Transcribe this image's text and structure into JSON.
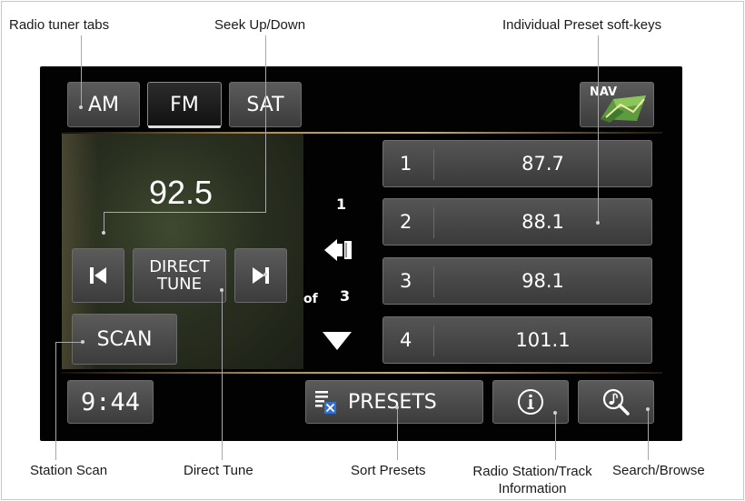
{
  "callouts": {
    "radio_tuner_tabs": "Radio tuner tabs",
    "seek_up_down": "Seek Up/Down",
    "individual_presets": "Individual Preset soft-keys",
    "station_scan": "Station Scan",
    "direct_tune": "Direct Tune",
    "sort_presets": "Sort Presets",
    "station_info_line1": "Radio Station/Track",
    "station_info_line2": "Information",
    "search_browse": "Search/Browse"
  },
  "tabs": [
    {
      "label": "AM",
      "active": false
    },
    {
      "label": "FM",
      "active": true
    },
    {
      "label": "SAT",
      "active": false
    }
  ],
  "nav_label": "NAV",
  "current_frequency": "92.5",
  "direct_tune": {
    "line1": "DIRECT",
    "line2": "TUNE"
  },
  "scan_label": "SCAN",
  "page_indicator": {
    "current": "1",
    "of_label": "of",
    "total": "3"
  },
  "presets": [
    {
      "number": "1",
      "frequency": "87.7"
    },
    {
      "number": "2",
      "frequency": "88.1"
    },
    {
      "number": "3",
      "frequency": "98.1"
    },
    {
      "number": "4",
      "frequency": "101.1"
    }
  ],
  "clock": "9:44",
  "presets_button_label": "PRESETS",
  "icons": {
    "seek_down": "skip-previous-icon",
    "seek_up": "skip-next-icon",
    "page_back": "back-arrow-icon",
    "page_down": "triangle-down-icon",
    "sort_presets": "sort-list-icon",
    "info": "info-icon",
    "search_browse": "music-search-icon",
    "nav": "map-icon"
  },
  "colors": {
    "accent_gold": "#c9a24a",
    "button_gray": "#4a4a4a",
    "screen_bg": "#020202",
    "sort_icon_blue": "#2f6fd6"
  }
}
